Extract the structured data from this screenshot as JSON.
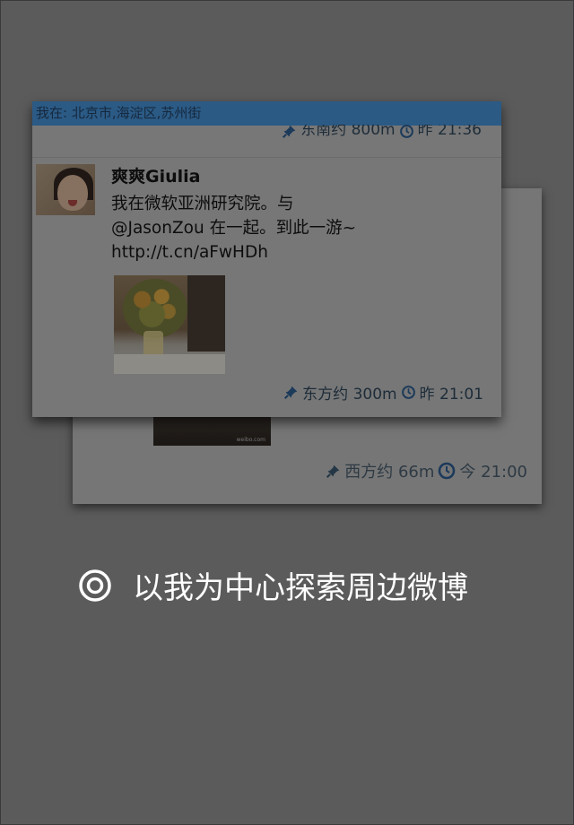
{
  "front_card": {
    "location_bar": "我在: 北京市,海淀区,苏州街",
    "prev_meta": {
      "direction": "东南约 800m",
      "time": "昨 21:36"
    },
    "username": "爽爽Giulia",
    "text": "我在微软亚洲研究院。与\n@JasonZou 在一起。到此一游~\nhttp://t.cn/aFwHDh",
    "meta": {
      "direction": "东方约 300m",
      "time": "昨 21:01"
    }
  },
  "back_card": {
    "meta": {
      "direction": "西方约 66m",
      "time": "今 21:00"
    },
    "photo_watermark": "weibo.com"
  },
  "explore_text": "以我为中心探索周边微博",
  "icons": [
    "pin-icon",
    "clock-icon",
    "target-icon"
  ]
}
